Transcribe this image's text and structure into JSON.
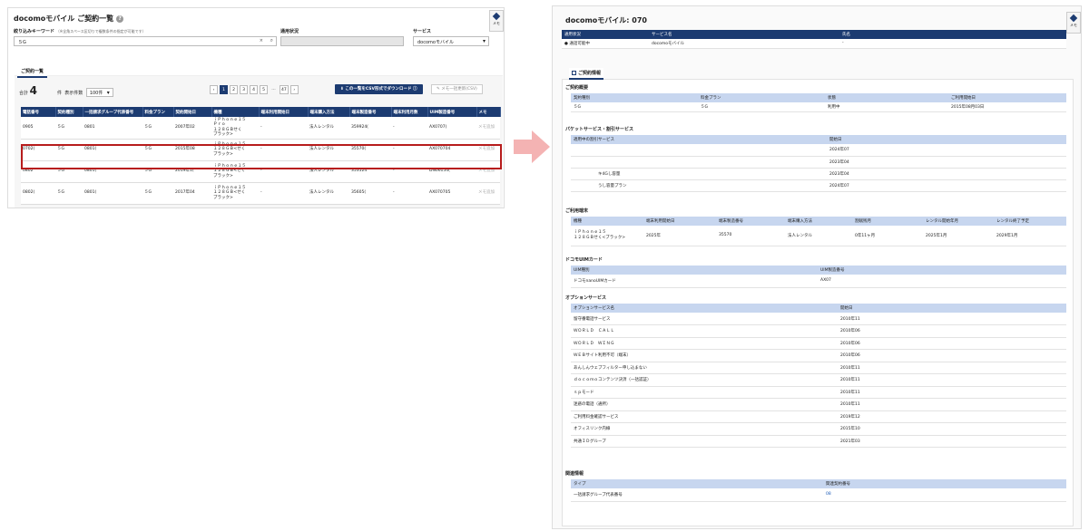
{
  "left": {
    "title": "docomoモバイル ご契約一覧",
    "memo_label": "メモ",
    "keyword": {
      "label": "絞り込みキーワード",
      "hint": "（※全角スペース区切りで複数条件の指定が可能です）",
      "value": "５G"
    },
    "status": {
      "label": "通用状況",
      "value": ""
    },
    "service": {
      "label": "サービス",
      "value": "docomoモバイル"
    },
    "tab": "ご契約一覧",
    "total_label": "合計",
    "total_value": "4",
    "unit": "件",
    "per_page_label": "表示件数",
    "per_page_value": "100件",
    "pager": [
      "‹",
      "1",
      "2",
      "3",
      "4",
      "5",
      "…",
      "47",
      "›"
    ],
    "download_button": "この一覧をCSV形式でダウンロード",
    "memo_download_button": "メモ一括更新(CSV)",
    "columns": [
      "電話番号",
      "契約種別",
      "一括請求グループ代表番号",
      "料金プラン",
      "契約開始日",
      "機種",
      "端末利用開始日",
      "端末購入方法",
      "端末製造番号",
      "端末利用月数",
      "UIM製造番号",
      "メモ"
    ],
    "rows": [
      {
        "phone": "0905",
        "type": "５G",
        "group": "0801",
        "plan": "５G",
        "start": "2007年02",
        "device": "ｉＰｈｏｎｅ１５\nＰｒｏ\n１２８ＧＢせく\nブラック>",
        "dev_start": "-",
        "method": "法人レンタル",
        "serial": "359924(",
        "months": "-",
        "uim": "AX0707(",
        "memo": "メモ追加"
      },
      {
        "phone": "0702(",
        "type": "５G",
        "group": "0801(",
        "plan": "５G",
        "start": "2015年08",
        "device": "ｉＰｈｏｎｅ１５\n１２８ＧＢ<せく\nブラック>",
        "dev_start": "-",
        "method": "法人レンタル",
        "serial": "35570(",
        "months": "-",
        "uim": "AX070704",
        "memo": "メモ追加"
      },
      {
        "phone": "0802",
        "type": "５G",
        "group": "0801(",
        "plan": "５G",
        "start": "2019年1(",
        "device": "ｉＰｈｏｎｅ１５\n１２８ＧＢ<せく\nブラック>",
        "dev_start": "-",
        "method": "法人レンタル",
        "serial": "353524",
        "months": "-",
        "uim": "DN06154(",
        "memo": "メモ追加"
      },
      {
        "phone": "0802(",
        "type": "５G",
        "group": "0801(",
        "plan": "５G",
        "start": "2017年04",
        "device": "ｉＰｈｏｎｅ１５\n１２８ＧＢ<せく\nブラック>",
        "dev_start": "-",
        "method": "法人レンタル",
        "serial": "35605(",
        "months": "-",
        "uim": "AX070705",
        "memo": "メモ追加"
      }
    ]
  },
  "right": {
    "title": "docomoモバイル: 070",
    "memo_label": "メモ",
    "header_cols": [
      "通用状況",
      "サービス名",
      "氏名"
    ],
    "header_vals": [
      "● 通話可能中",
      "docomoモバイル",
      "-"
    ],
    "tab": "ご契約情報",
    "summary": {
      "title": "ご契約概要",
      "cols": [
        "契約種別",
        "料金プラン",
        "状態",
        "ご利用開始日"
      ],
      "vals": [
        "５G",
        "５G",
        "利用中",
        "2015年08月03日"
      ]
    },
    "packet": {
      "title": "パケットサービス・割引サービス",
      "cols": [
        "適用中の割引サービス",
        "開始日"
      ],
      "rows": [
        [
          "",
          "2024年07"
        ],
        [
          "",
          "2023年04"
        ],
        [
          "キ4Gし容量",
          "2023年04"
        ],
        [
          "うし容量プラン",
          "2024年07"
        ]
      ]
    },
    "device": {
      "title": "ご利用端末",
      "cols": [
        "機種",
        "端末利用開始日",
        "端末製造番号",
        "端末購入方法",
        "割賦残月",
        "レンタル開始年月",
        "レンタル終了予定"
      ],
      "vals": [
        "ｉＰｈｏｎｅ１５\n１２８ＧＢせく<ブラック>",
        "2025年",
        "35570",
        "法人レンタル",
        "0年11ヶ月",
        "2025年1月",
        "2029年1月"
      ]
    },
    "uim": {
      "title": "ドコモUIMカード",
      "cols": [
        "UIM種別",
        "UIM製造番号"
      ],
      "vals": [
        "ドコモnanoUIMカード",
        "AX07"
      ]
    },
    "options": {
      "title": "オプションサービス",
      "cols": [
        "オプションサービス名",
        "開始日"
      ],
      "rows": [
        [
          "留守番電話サービス",
          "2010年11"
        ],
        [
          "ＷＯＲＬＤ　ＣＡＬＬ",
          "2010年06"
        ],
        [
          "ＷＯＲＬＤ　ＷＩＮＧ",
          "2010年06"
        ],
        [
          "ＷＥＢサイト利用不可（端末）",
          "2010年06"
        ],
        [
          "あんしんウェブフィルター申し込まない",
          "2010年11"
        ],
        [
          "ｄｏｃｏｍｏコンテンツ決済（一括認証）",
          "2010年11"
        ],
        [
          "ｓｐモード",
          "2010年11"
        ],
        [
          "迷惑の電話（通所）",
          "2010年11"
        ],
        [
          "ご利用料金確認サービス",
          "2019年12"
        ],
        [
          "オフィスリンク内線",
          "2015年10"
        ],
        [
          "共通ＩＤグループ",
          "2021年03"
        ]
      ]
    },
    "related": {
      "title": "関連情報",
      "cols": [
        "タイプ",
        "関連契約番号"
      ],
      "vals": [
        "一括請求グループ代表番号",
        "08"
      ]
    }
  }
}
